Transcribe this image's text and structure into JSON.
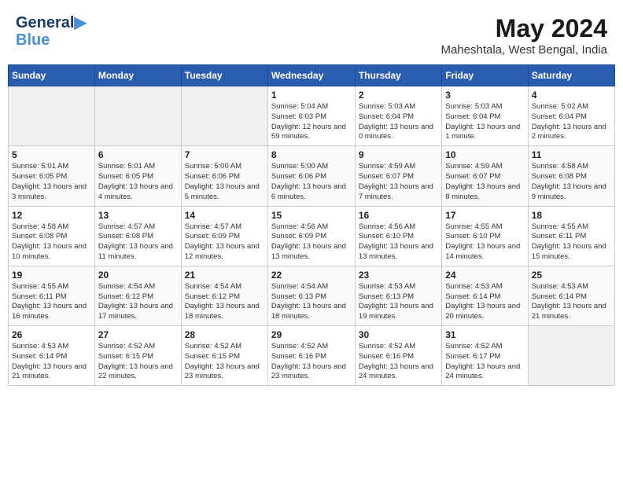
{
  "header": {
    "logo_line1": "General",
    "logo_line2": "Blue",
    "month": "May 2024",
    "location": "Maheshtala, West Bengal, India"
  },
  "weekdays": [
    "Sunday",
    "Monday",
    "Tuesday",
    "Wednesday",
    "Thursday",
    "Friday",
    "Saturday"
  ],
  "weeks": [
    [
      {
        "day": "",
        "info": ""
      },
      {
        "day": "",
        "info": ""
      },
      {
        "day": "",
        "info": ""
      },
      {
        "day": "1",
        "info": "Sunrise: 5:04 AM\nSunset: 6:03 PM\nDaylight: 12 hours and 59 minutes."
      },
      {
        "day": "2",
        "info": "Sunrise: 5:03 AM\nSunset: 6:04 PM\nDaylight: 13 hours and 0 minutes."
      },
      {
        "day": "3",
        "info": "Sunrise: 5:03 AM\nSunset: 6:04 PM\nDaylight: 13 hours and 1 minute."
      },
      {
        "day": "4",
        "info": "Sunrise: 5:02 AM\nSunset: 6:04 PM\nDaylight: 13 hours and 2 minutes."
      }
    ],
    [
      {
        "day": "5",
        "info": "Sunrise: 5:01 AM\nSunset: 6:05 PM\nDaylight: 13 hours and 3 minutes."
      },
      {
        "day": "6",
        "info": "Sunrise: 5:01 AM\nSunset: 6:05 PM\nDaylight: 13 hours and 4 minutes."
      },
      {
        "day": "7",
        "info": "Sunrise: 5:00 AM\nSunset: 6:06 PM\nDaylight: 13 hours and 5 minutes."
      },
      {
        "day": "8",
        "info": "Sunrise: 5:00 AM\nSunset: 6:06 PM\nDaylight: 13 hours and 6 minutes."
      },
      {
        "day": "9",
        "info": "Sunrise: 4:59 AM\nSunset: 6:07 PM\nDaylight: 13 hours and 7 minutes."
      },
      {
        "day": "10",
        "info": "Sunrise: 4:59 AM\nSunset: 6:07 PM\nDaylight: 13 hours and 8 minutes."
      },
      {
        "day": "11",
        "info": "Sunrise: 4:58 AM\nSunset: 6:08 PM\nDaylight: 13 hours and 9 minutes."
      }
    ],
    [
      {
        "day": "12",
        "info": "Sunrise: 4:58 AM\nSunset: 6:08 PM\nDaylight: 13 hours and 10 minutes."
      },
      {
        "day": "13",
        "info": "Sunrise: 4:57 AM\nSunset: 6:08 PM\nDaylight: 13 hours and 11 minutes."
      },
      {
        "day": "14",
        "info": "Sunrise: 4:57 AM\nSunset: 6:09 PM\nDaylight: 13 hours and 12 minutes."
      },
      {
        "day": "15",
        "info": "Sunrise: 4:56 AM\nSunset: 6:09 PM\nDaylight: 13 hours and 13 minutes."
      },
      {
        "day": "16",
        "info": "Sunrise: 4:56 AM\nSunset: 6:10 PM\nDaylight: 13 hours and 13 minutes."
      },
      {
        "day": "17",
        "info": "Sunrise: 4:55 AM\nSunset: 6:10 PM\nDaylight: 13 hours and 14 minutes."
      },
      {
        "day": "18",
        "info": "Sunrise: 4:55 AM\nSunset: 6:11 PM\nDaylight: 13 hours and 15 minutes."
      }
    ],
    [
      {
        "day": "19",
        "info": "Sunrise: 4:55 AM\nSunset: 6:11 PM\nDaylight: 13 hours and 16 minutes."
      },
      {
        "day": "20",
        "info": "Sunrise: 4:54 AM\nSunset: 6:12 PM\nDaylight: 13 hours and 17 minutes."
      },
      {
        "day": "21",
        "info": "Sunrise: 4:54 AM\nSunset: 6:12 PM\nDaylight: 13 hours and 18 minutes."
      },
      {
        "day": "22",
        "info": "Sunrise: 4:54 AM\nSunset: 6:13 PM\nDaylight: 13 hours and 18 minutes."
      },
      {
        "day": "23",
        "info": "Sunrise: 4:53 AM\nSunset: 6:13 PM\nDaylight: 13 hours and 19 minutes."
      },
      {
        "day": "24",
        "info": "Sunrise: 4:53 AM\nSunset: 6:14 PM\nDaylight: 13 hours and 20 minutes."
      },
      {
        "day": "25",
        "info": "Sunrise: 4:53 AM\nSunset: 6:14 PM\nDaylight: 13 hours and 21 minutes."
      }
    ],
    [
      {
        "day": "26",
        "info": "Sunrise: 4:53 AM\nSunset: 6:14 PM\nDaylight: 13 hours and 21 minutes."
      },
      {
        "day": "27",
        "info": "Sunrise: 4:52 AM\nSunset: 6:15 PM\nDaylight: 13 hours and 22 minutes."
      },
      {
        "day": "28",
        "info": "Sunrise: 4:52 AM\nSunset: 6:15 PM\nDaylight: 13 hours and 23 minutes."
      },
      {
        "day": "29",
        "info": "Sunrise: 4:52 AM\nSunset: 6:16 PM\nDaylight: 13 hours and 23 minutes."
      },
      {
        "day": "30",
        "info": "Sunrise: 4:52 AM\nSunset: 6:16 PM\nDaylight: 13 hours and 24 minutes."
      },
      {
        "day": "31",
        "info": "Sunrise: 4:52 AM\nSunset: 6:17 PM\nDaylight: 13 hours and 24 minutes."
      },
      {
        "day": "",
        "info": ""
      }
    ]
  ]
}
